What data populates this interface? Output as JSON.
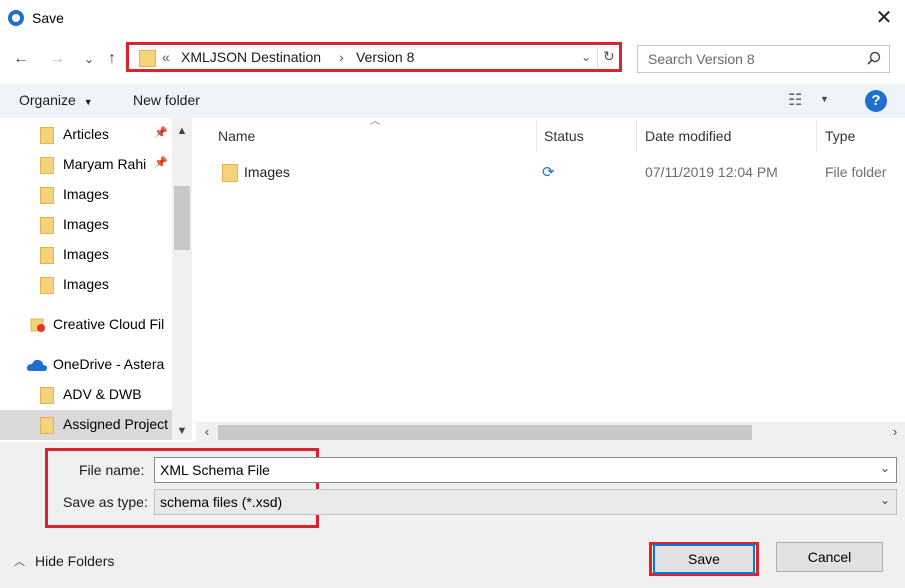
{
  "window": {
    "title": "Save",
    "close_glyph": "✕"
  },
  "nav": {
    "back_glyph": "←",
    "forward_glyph": "→",
    "recent_glyph": "⌄",
    "up_glyph": "↑",
    "address_prefix": "«",
    "path": [
      "XMLJSON Destination",
      "Version 8"
    ],
    "path_sep": "›",
    "dropdown_glyph": "⌄",
    "refresh_glyph": "↻",
    "search_placeholder": "Search Version 8"
  },
  "toolbar": {
    "organize_label": "Organize",
    "new_folder_label": "New folder",
    "view_glyph": "☷",
    "help_glyph": "?"
  },
  "sidebar": {
    "items": [
      {
        "label": "Articles",
        "pinned": true
      },
      {
        "label": "Maryam Rahi",
        "pinned": true
      },
      {
        "label": "Images",
        "pinned": false
      },
      {
        "label": "Images",
        "pinned": false
      },
      {
        "label": "Images",
        "pinned": false
      },
      {
        "label": "Images",
        "pinned": false
      }
    ],
    "creative_cloud": "Creative Cloud Fil",
    "onedrive": "OneDrive - Astera",
    "sub_items": [
      "ADV & DWB",
      "Assigned Project"
    ]
  },
  "filelist": {
    "columns": [
      "Name",
      "Status",
      "Date modified",
      "Type"
    ],
    "rows": [
      {
        "name": "Images",
        "date": "07/11/2019 12:04 PM",
        "type": "File folder"
      }
    ]
  },
  "form": {
    "file_name_label": "File name:",
    "file_name_value": "XML Schema File",
    "save_type_label": "Save as type:",
    "save_type_value": "schema files (*.xsd)"
  },
  "footer": {
    "hide_folders_label": "Hide Folders",
    "save_label": "Save",
    "cancel_label": "Cancel"
  },
  "colors": {
    "highlight": "#d9232e",
    "accent": "#1f6fd1",
    "folder": "#f6d27a"
  }
}
